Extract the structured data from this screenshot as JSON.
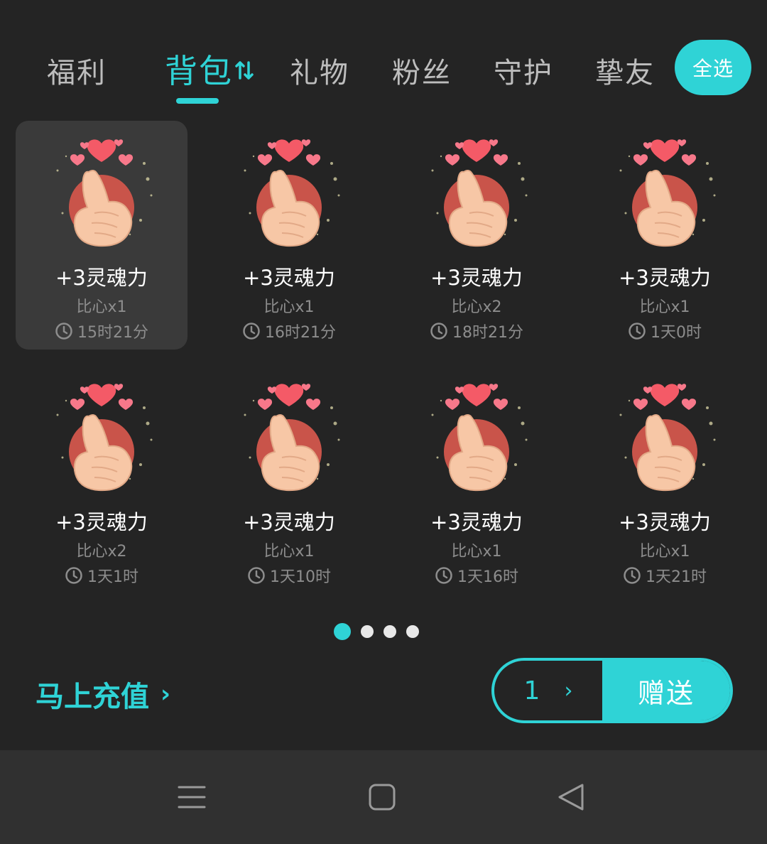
{
  "tabs": [
    {
      "label": "福利"
    },
    {
      "label": "背包"
    },
    {
      "label": "礼物"
    },
    {
      "label": "粉丝"
    },
    {
      "label": "守护"
    },
    {
      "label": "挚友"
    }
  ],
  "active_tab": "背包",
  "select_all_label": "全选",
  "gifts": [
    {
      "name": "+3灵魂力",
      "count": "比心x1",
      "time": "15时21分",
      "selected": true
    },
    {
      "name": "+3灵魂力",
      "count": "比心x1",
      "time": "16时21分"
    },
    {
      "name": "+3灵魂力",
      "count": "比心x2",
      "time": "18时21分"
    },
    {
      "name": "+3灵魂力",
      "count": "比心x1",
      "time": "1天0时"
    },
    {
      "name": "+3灵魂力",
      "count": "比心x2",
      "time": "1天1时"
    },
    {
      "name": "+3灵魂力",
      "count": "比心x1",
      "time": "1天10时"
    },
    {
      "name": "+3灵魂力",
      "count": "比心x1",
      "time": "1天16时"
    },
    {
      "name": "+3灵魂力",
      "count": "比心x1",
      "time": "1天21时"
    }
  ],
  "pager": {
    "pages": 4,
    "current": 1
  },
  "recharge_label": "马上充值",
  "quantity": "1",
  "send_label": "赠送",
  "colors": {
    "accent": "#2fd3d6",
    "background": "#242424",
    "navbar": "#303030"
  },
  "icons": {
    "sort": "sort-arrows-icon",
    "clock": "clock-icon",
    "gift": "finger-heart-icon",
    "nav": [
      "menu-icon",
      "home-icon",
      "back-icon"
    ]
  }
}
